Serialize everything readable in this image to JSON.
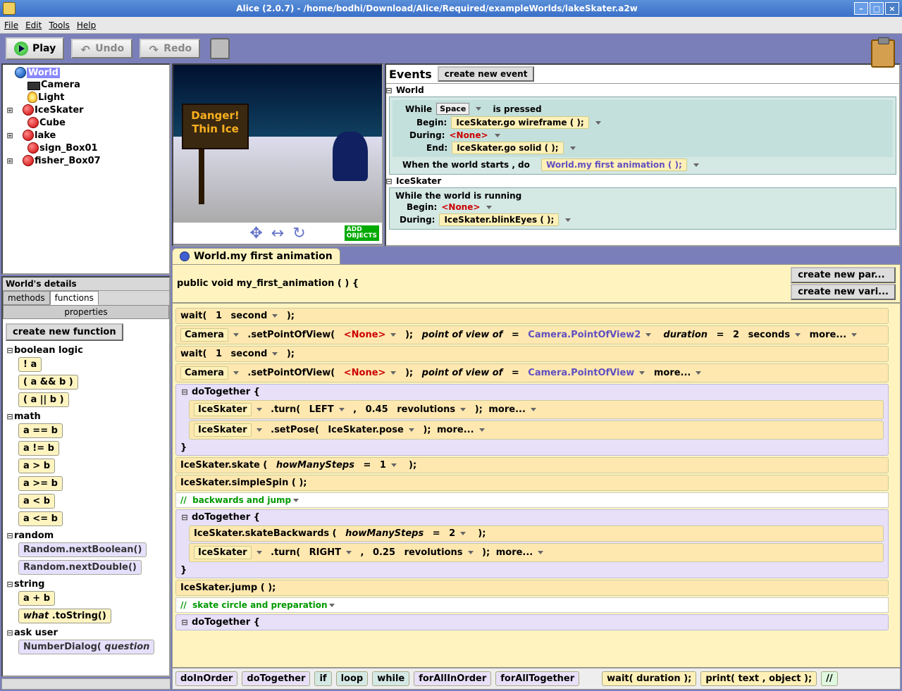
{
  "title": "Alice (2.0.7) - /home/bodhi/Download/Alice/Required/exampleWorlds/lakeSkater.a2w",
  "menus": [
    "File",
    "Edit",
    "Tools",
    "Help"
  ],
  "toolbar": {
    "play": "Play",
    "undo": "Undo",
    "redo": "Redo"
  },
  "tree": {
    "root": "World",
    "items": [
      "Camera",
      "Light",
      "IceSkater",
      "Cube",
      "lake",
      "sign_Box01",
      "fisher_Box07"
    ]
  },
  "details": {
    "title": "World's details",
    "tabs": [
      "methods",
      "functions",
      "properties"
    ],
    "createFunc": "create new function",
    "cats": {
      "bool": {
        "name": "boolean logic",
        "items": [
          "! a",
          "( a && b )",
          "( a || b )"
        ]
      },
      "math": {
        "name": "math",
        "items": [
          "a == b",
          "a != b",
          "a > b",
          "a >= b",
          "a < b",
          "a <= b"
        ]
      },
      "random": {
        "name": "random",
        "items": [
          "Random.nextBoolean()",
          "Random.nextDouble()"
        ]
      },
      "string": {
        "name": "string",
        "items": [
          "a + b",
          "what .toString()"
        ]
      },
      "ask": {
        "name": "ask user",
        "items": [
          "NumberDialog( question"
        ]
      }
    }
  },
  "scene": {
    "sign1": "Danger!",
    "sign2": "Thin Ice",
    "addObj": "ADD\nOBJECTS"
  },
  "events": {
    "title": "Events",
    "createBtn": "create new event",
    "world": "World",
    "iceskater": "IceSkater",
    "while": "While",
    "key": "Space",
    "pressed": "is pressed",
    "begin": "Begin:",
    "during": "During:",
    "end": "End:",
    "none": "<None>",
    "goWire": "IceSkater.go wireframe (    );",
    "goSolid": "IceSkater.go solid (    );",
    "whenStarts": "When the world starts ,  do",
    "worldAnim": "World.my first animation (    );",
    "whileRunning": "While the world is running",
    "blinkEyes": "IceSkater.blinkEyes (    );"
  },
  "code": {
    "tab": "World.my first animation",
    "sig": "public void my_first_animation ( ) {",
    "newPar": "create new par...",
    "newVar": "create new vari...",
    "wait": "wait(",
    "one": "1",
    "second": "second",
    "close": ");",
    "camera": "Camera",
    "setPov": ".setPointOfView(",
    "none": "<None>",
    "povOf": "point of view of",
    "eq": "=",
    "pov2": "Camera.PointOfView2",
    "pov": "Camera.PointOfView",
    "duration": "duration",
    "two": "2",
    "seconds": "seconds",
    "more": "more...",
    "doTog": "doTogether {",
    "closeBrace": "}",
    "iceSkater": "IceSkater",
    "turn": ".turn(",
    "left": "LEFT",
    "right": "RIGHT",
    "r045": "0.45",
    "r025": "0.25",
    "revs": "revolutions",
    "comma": ",",
    "setPose": ".setPose(",
    "pose": "IceSkater.pose",
    "skate": "IceSkater.skate (",
    "howMany": "howManySteps",
    "s1": "1",
    "s2": "2",
    "simpleSpin": "IceSkater.simpleSpin (    );",
    "comment1": "backwards and jump",
    "comment2": "skate circle and preparation",
    "skateBack": "IceSkater.skateBackwards (",
    "jump": "IceSkater.jump (    );",
    "slashes": "//"
  },
  "footer": {
    "doInOrder": "doInOrder",
    "doTogether": "doTogether",
    "if": "if",
    "loop": "loop",
    "while": "while",
    "forAllInOrder": "forAllInOrder",
    "forAllTogether": "forAllTogether",
    "waitDur": "wait( duration );",
    "print": "print( text , object );",
    "comment": "//"
  }
}
